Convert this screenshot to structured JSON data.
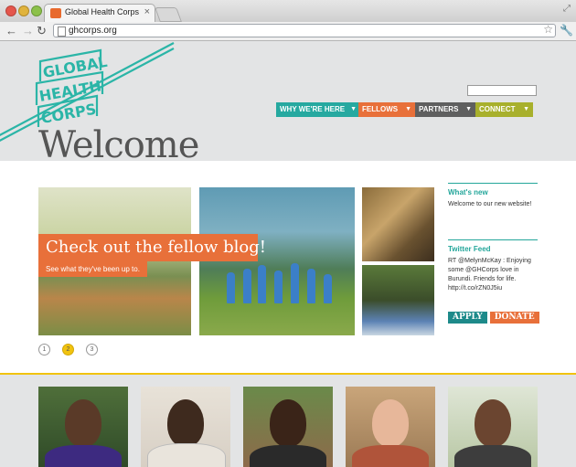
{
  "browser": {
    "tab_title": "Global Health Corps",
    "tab_close": "×",
    "url": "ghcorps.org"
  },
  "logo": {
    "lines": [
      "GLOBAL",
      "HEALTH",
      "CORPS"
    ],
    "color": "#2bb5a7"
  },
  "nav": {
    "items": [
      {
        "label": "WHY WE'RE HERE",
        "color": "#26a9a0"
      },
      {
        "label": "FELLOWS",
        "color": "#e8703a"
      },
      {
        "label": "PARTNERS",
        "color": "#5f5f5f"
      },
      {
        "label": "CONNECT",
        "color": "#a8b02c"
      }
    ],
    "caret": "▼"
  },
  "page_title": "Welcome",
  "slider": {
    "banner_title": "Check out the fellow blog!",
    "banner_subtitle": "See what they've been up to.",
    "pages": [
      "1",
      "2",
      "3"
    ],
    "active_page": "2"
  },
  "sidebar": {
    "whats_new_heading": "What's new",
    "whats_new_text": "Welcome to our new website!",
    "twitter_heading": "Twitter Feed",
    "twitter_text": "RT @MelynMcKay  : Enjoying some @GHCorps love in Burundi. Friends for life. http://t.co/rZN0J5iu"
  },
  "cta": {
    "apply": "APPLY",
    "donate": "DONATE"
  },
  "colors": {
    "teal": "#23a69a",
    "orange": "#e8703a",
    "yellow": "#f1c30f",
    "olive": "#a8b02c"
  }
}
